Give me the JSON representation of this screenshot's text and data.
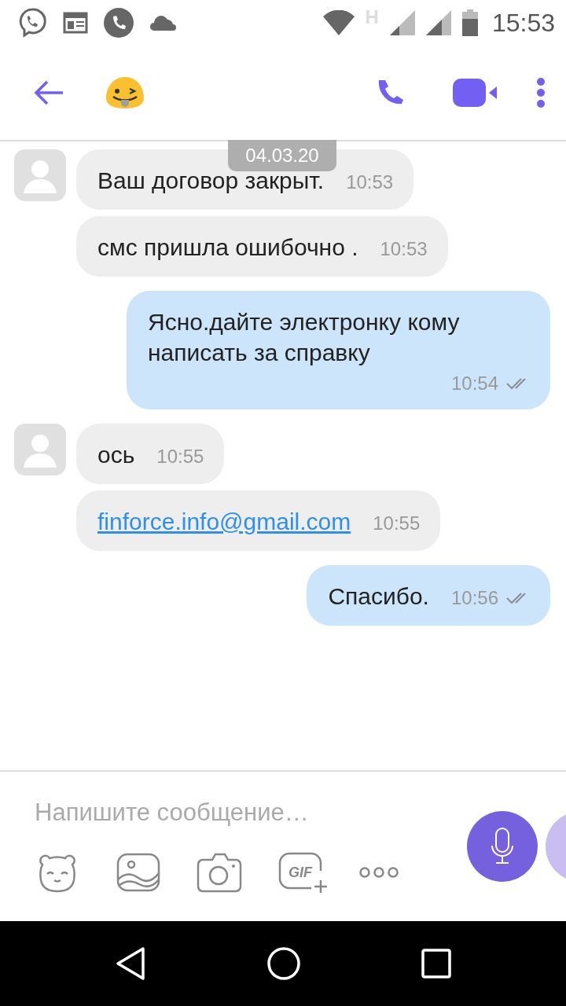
{
  "status_bar": {
    "network_type": "H",
    "time": "15:53"
  },
  "date_chip": "04.03.20",
  "messages": [
    {
      "kind": "incoming",
      "show_avatar": true,
      "text": "Ваш договор закрыт.",
      "time": "10:53",
      "is_link": false,
      "read": false
    },
    {
      "kind": "incoming",
      "show_avatar": false,
      "text": "смс пришла ошибочно .",
      "time": "10:53",
      "is_link": false,
      "read": false
    },
    {
      "kind": "outgoing",
      "show_avatar": false,
      "text": "Ясно.дайте электронку кому написать за справку",
      "time": "10:54",
      "is_link": false,
      "read": true
    },
    {
      "kind": "incoming",
      "show_avatar": true,
      "text": "ось",
      "time": "10:55",
      "is_link": false,
      "read": false
    },
    {
      "kind": "incoming",
      "show_avatar": false,
      "text": "finforce.info@gmail.com",
      "time": "10:55",
      "is_link": true,
      "read": false
    },
    {
      "kind": "outgoing",
      "show_avatar": false,
      "text": "Спасибо.",
      "time": "10:56",
      "is_link": false,
      "read": true
    }
  ],
  "composer": {
    "placeholder": "Напишите сообщение…",
    "gif_label": "GIF"
  }
}
